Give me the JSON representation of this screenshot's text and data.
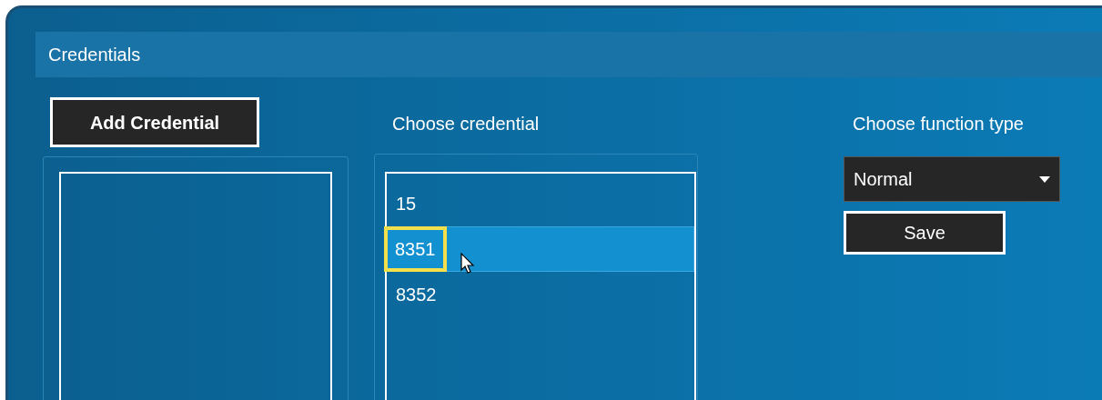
{
  "section": {
    "title": "Credentials"
  },
  "add_button": "Add Credential",
  "credential_list": {
    "label": "Choose credential",
    "items": [
      {
        "text": "15",
        "selected": false,
        "highlighted": false
      },
      {
        "text": "8351",
        "selected": true,
        "highlighted": true
      },
      {
        "text": "8352",
        "selected": false,
        "highlighted": false
      }
    ]
  },
  "function_type": {
    "label": "Choose function type",
    "value": "Normal"
  },
  "save_button": "Save"
}
